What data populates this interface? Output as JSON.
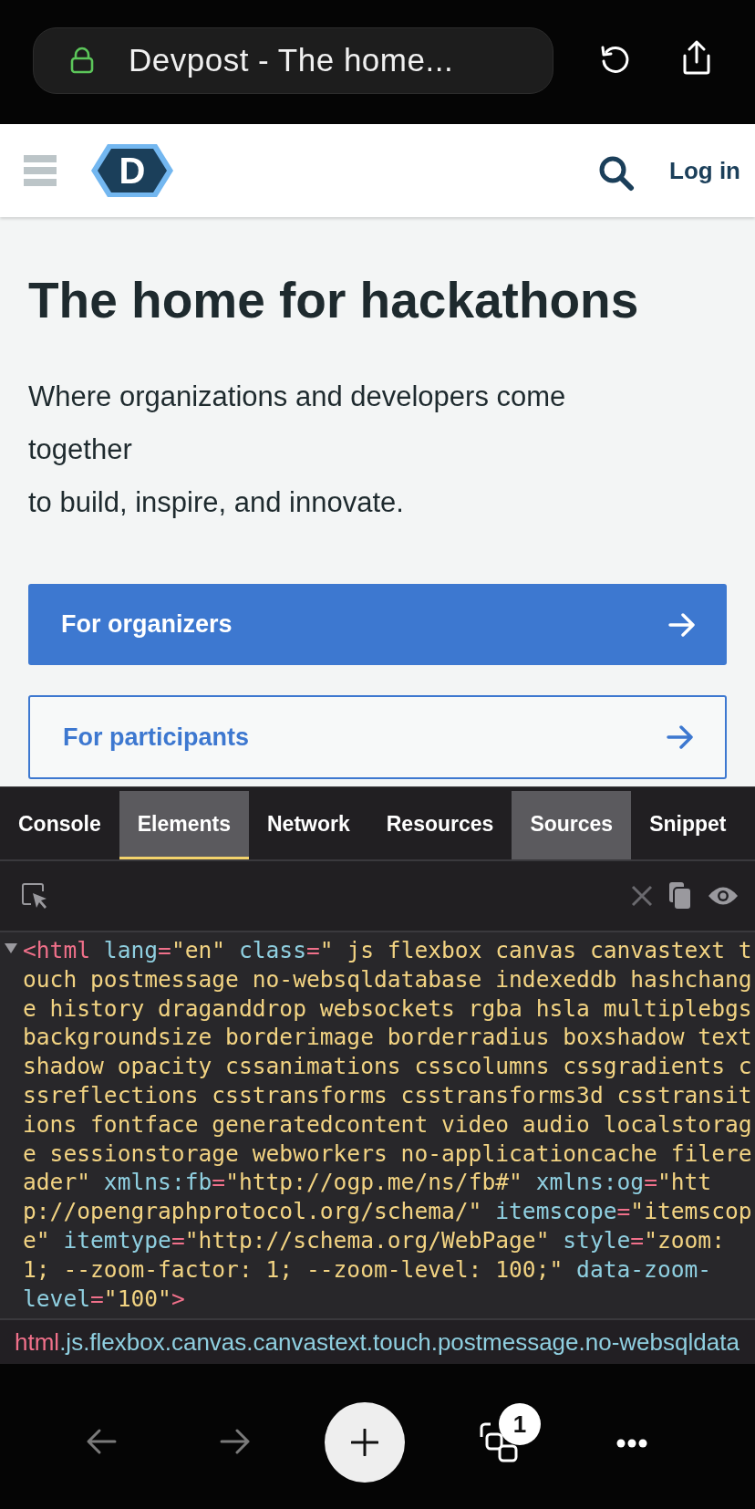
{
  "browser_bar": {
    "title": "Devpost - The home...",
    "secure": true
  },
  "site_header": {
    "logo_letter": "D",
    "login": "Log in"
  },
  "hero": {
    "heading": "The home for hackathons",
    "lines": [
      "Where organizations and developers come together",
      "to build, inspire, and innovate."
    ],
    "buttons": [
      {
        "label": "For organizers",
        "kind": "primary"
      },
      {
        "label": "For participants",
        "kind": "outline"
      }
    ]
  },
  "devtools": {
    "tabs": [
      {
        "label": "Console",
        "selected": false,
        "pressed": false
      },
      {
        "label": "Elements",
        "selected": true,
        "pressed": true
      },
      {
        "label": "Network",
        "selected": false,
        "pressed": false
      },
      {
        "label": "Resources",
        "selected": false,
        "pressed": false
      },
      {
        "label": "Sources",
        "selected": false,
        "pressed": true
      },
      {
        "label": "Snippet",
        "selected": false,
        "pressed": false
      }
    ],
    "node": {
      "expanded": true,
      "lines": [
        [
          {
            "kind": "tag",
            "text": "<html"
          },
          {
            "kind": "attr",
            "text": " lang"
          },
          {
            "kind": "punct",
            "text": "="
          },
          {
            "kind": "value",
            "text": "\"en\""
          },
          {
            "kind": "attr",
            "text": " class"
          },
          {
            "kind": "punct",
            "text": "="
          },
          {
            "kind": "value",
            "text": "\" js flexbox canvas canvastext t"
          }
        ],
        [
          {
            "kind": "value",
            "text": "ouch postmessage no-websqldatabase indexeddb hashchang"
          }
        ],
        [
          {
            "kind": "value",
            "text": "e history draganddrop websockets rgba hsla multiplebgs"
          }
        ],
        [
          {
            "kind": "value",
            "text": "backgroundsize borderimage borderradius boxshadow text"
          }
        ],
        [
          {
            "kind": "value",
            "text": "shadow opacity cssanimations csscolumns cssgradients c"
          }
        ],
        [
          {
            "kind": "value",
            "text": "ssreflections csstransforms csstransforms3d csstransit"
          }
        ],
        [
          {
            "kind": "value",
            "text": "ions fontface generatedcontent video audio localstorag"
          }
        ],
        [
          {
            "kind": "value",
            "text": "e sessionstorage webworkers no-applicationcache filere"
          }
        ],
        [
          {
            "kind": "value",
            "text": "ader\""
          },
          {
            "kind": "attr",
            "text": " xmlns:fb"
          },
          {
            "kind": "punct",
            "text": "="
          },
          {
            "kind": "value",
            "text": "\"http://ogp.me/ns/fb#\""
          },
          {
            "kind": "attr",
            "text": " xmlns:og"
          },
          {
            "kind": "punct",
            "text": "="
          },
          {
            "kind": "value",
            "text": "\"htt"
          }
        ],
        [
          {
            "kind": "value",
            "text": "p://opengraphprotocol.org/schema/\""
          },
          {
            "kind": "attr",
            "text": " itemscope"
          },
          {
            "kind": "punct",
            "text": "="
          },
          {
            "kind": "value",
            "text": "\"itemscop"
          }
        ],
        [
          {
            "kind": "value",
            "text": "e\""
          },
          {
            "kind": "attr",
            "text": " itemtype"
          },
          {
            "kind": "punct",
            "text": "="
          },
          {
            "kind": "value",
            "text": "\"http://schema.org/WebPage\""
          },
          {
            "kind": "attr",
            "text": " style"
          },
          {
            "kind": "punct",
            "text": "="
          },
          {
            "kind": "value",
            "text": "\"zoom:"
          }
        ],
        [
          {
            "kind": "value",
            "text": "1; --zoom-factor: 1; --zoom-level: 100;\""
          },
          {
            "kind": "attr",
            "text": " data-zoom-"
          }
        ],
        [
          {
            "kind": "attr",
            "text": "level"
          },
          {
            "kind": "punct",
            "text": "="
          },
          {
            "kind": "value",
            "text": "\"100\""
          },
          {
            "kind": "tag",
            "text": ">"
          }
        ]
      ]
    },
    "breadcrumb": [
      {
        "kind": "tag",
        "text": "html"
      },
      {
        "kind": "cls",
        "text": ".js.flexbox.canvas.canvastext.touch.postmessage.no-websqldata"
      }
    ]
  },
  "bottom_bar": {
    "back": {
      "disabled": true
    },
    "forward": {
      "disabled": true
    },
    "tab_count": "1"
  }
}
